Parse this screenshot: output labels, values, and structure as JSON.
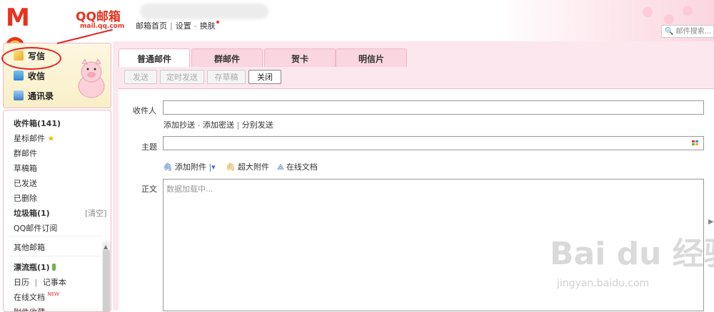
{
  "logo": {
    "brand": "Moil",
    "name": "QQ邮箱",
    "url": "mail.qq.com"
  },
  "toplinks": {
    "home": "邮箱首页",
    "settings": "设置",
    "skin": "换肤"
  },
  "search": {
    "placeholder": "邮件搜索..."
  },
  "actions": {
    "compose": "写信",
    "inbox": "收信",
    "contacts": "通讯录"
  },
  "folders": {
    "inbox": "收件箱(141)",
    "starred": "星标邮件",
    "group": "群邮件",
    "drafts": "草稿箱",
    "sent": "已发送",
    "deleted": "已删除",
    "spam": "垃圾箱(1)",
    "spam_clean": "[清空]",
    "subscription": "QQ邮件订阅",
    "other": "其他邮箱",
    "bottle": "漂流瓶(1)",
    "calendar": "日历",
    "notepad": "记事本",
    "docs": "在线文档",
    "docs_badge": "NEW",
    "attach_collect": "附件收藏"
  },
  "tabs": [
    "普通邮件",
    "群邮件",
    "贺卡",
    "明信片"
  ],
  "toolbar": {
    "send": "发送",
    "schedule": "定时发送",
    "save_draft": "存草稿",
    "close": "关闭"
  },
  "form": {
    "to_label": "收件人",
    "cc_link": "添加抄送",
    "dash": "-",
    "bcc_link": "添加密送",
    "separate_link": "分别发送",
    "subject_label": "主题",
    "attach_label": "添加附件",
    "large_attach_label": "超大附件",
    "online_doc_label": "在线文档",
    "body_label": "正文",
    "body_placeholder": "数据加载中..."
  },
  "watermark": {
    "main": "Bai du 经验",
    "sub": "jingyan.baidu.com"
  }
}
